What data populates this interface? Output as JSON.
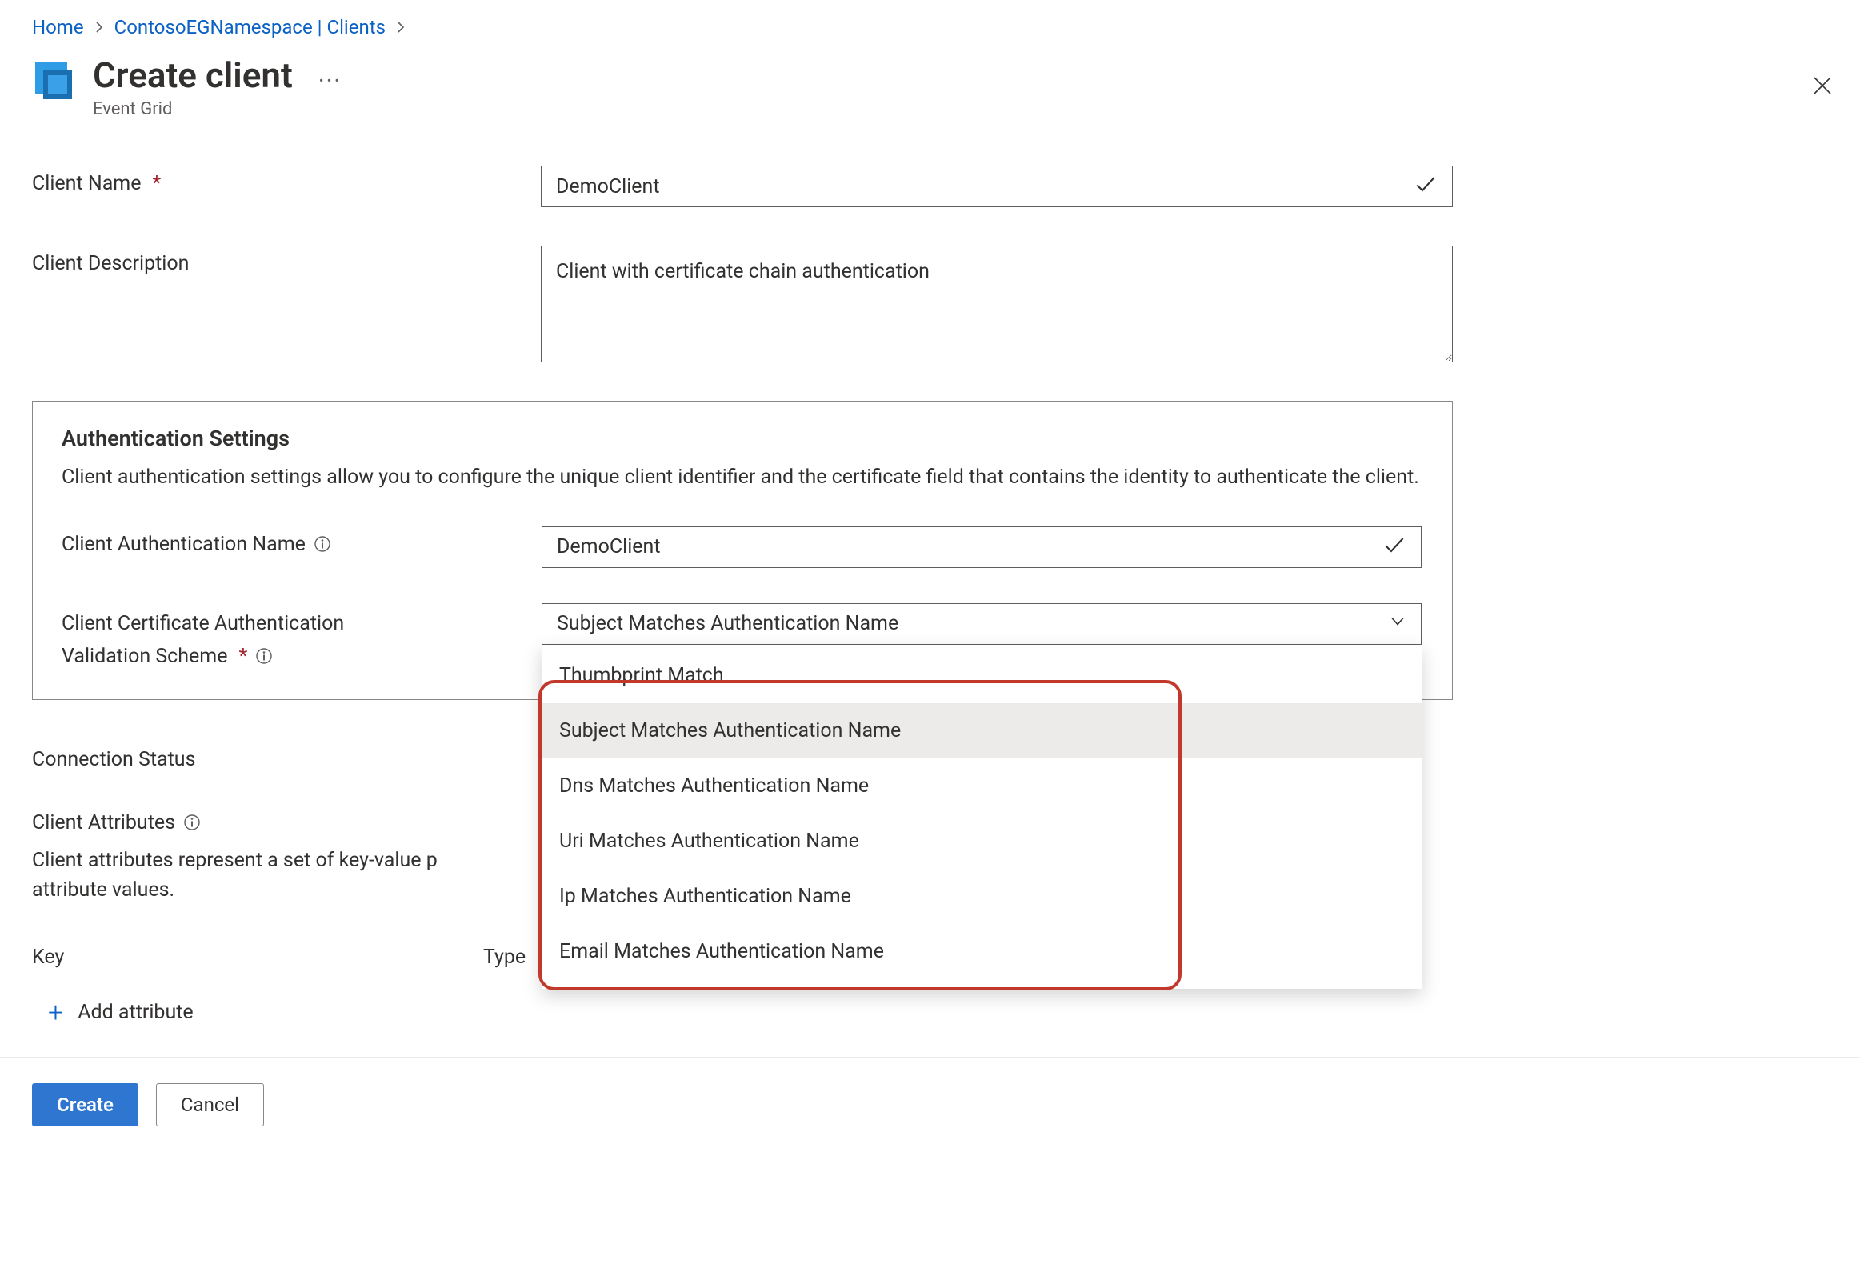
{
  "breadcrumb": {
    "home": "Home",
    "mid": "ContosoEGNamespace | Clients"
  },
  "header": {
    "title": "Create client",
    "subtitle": "Event Grid",
    "more": "···"
  },
  "fields": {
    "client_name_label": "Client Name",
    "client_name_value": "DemoClient",
    "client_desc_label": "Client Description",
    "client_desc_value": "Client with certificate chain authentication"
  },
  "auth": {
    "heading": "Authentication Settings",
    "desc": "Client authentication settings allow you to configure the unique client identifier and the certificate field that contains the identity to authenticate the client.",
    "auth_name_label": "Client Authentication Name",
    "auth_name_value": "DemoClient",
    "scheme_label_line1": "Client Certificate Authentication",
    "scheme_label_line2": "Validation Scheme",
    "scheme_value": "Subject Matches Authentication Name",
    "options": [
      "Thumbprint Match",
      "Subject Matches Authentication Name",
      "Dns Matches Authentication Name",
      "Uri Matches Authentication Name",
      "Ip Matches Authentication Name",
      "Email Matches Authentication Name"
    ]
  },
  "lower": {
    "connection_status_label": "Connection Status",
    "client_attributes_label": "Client Attributes",
    "client_attributes_desc_prefix": "Client attributes represent a set of key-value p",
    "client_attributes_desc_suffix": "s on common attribute values.",
    "key_header": "Key",
    "type_header": "Type",
    "add_attribute": "Add attribute"
  },
  "footer": {
    "create": "Create",
    "cancel": "Cancel"
  }
}
